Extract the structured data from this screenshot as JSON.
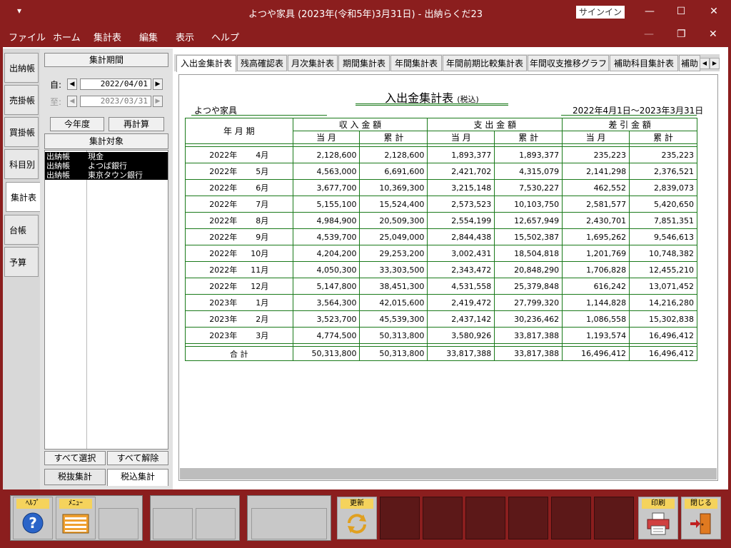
{
  "window": {
    "system_menu": "▾",
    "title": "よつや家具 (2023年(令和5年)3月31日)  -  出納らくだ23",
    "signin": "サインイン",
    "minimize": "—",
    "maximize": "☐",
    "close": "✕"
  },
  "menu": [
    "ファイル",
    "ホーム",
    "集計表",
    "編集",
    "表示",
    "ヘルプ"
  ],
  "menu_controls": {
    "minimize": "—",
    "restore": "❐",
    "close": "✕"
  },
  "left_tabs": [
    "出納帳",
    "売掛帳",
    "買掛帳",
    "科目別",
    "集計表",
    "台帳",
    "予算"
  ],
  "left_tab_active": "集計表",
  "period_panel": {
    "header": "集計期間",
    "from_label": "自:",
    "from_value": "2022/04/01",
    "to_label": "至:",
    "to_value": "2023/03/31",
    "this_year_button": "今年度",
    "recalc_button": "再計算"
  },
  "target_panel": {
    "header": "集計対象",
    "items": [
      {
        "type": "出納帳",
        "name": "現金"
      },
      {
        "type": "出納帳",
        "name": "よつば銀行"
      },
      {
        "type": "出納帳",
        "name": "東京タウン銀行"
      }
    ],
    "select_all": "すべて選択",
    "deselect_all": "すべて解除"
  },
  "tax_tabs": [
    "税抜集計",
    "税込集計"
  ],
  "tax_tab_active": "税込集計",
  "report_tabs": [
    "入出金集計表",
    "残高確認表",
    "月次集計表",
    "期間集計表",
    "年間集計表",
    "年間前期比較集計表",
    "年間収支推移グラフ",
    "補助科目集計表",
    "補助"
  ],
  "report_tab_active": "入出金集計表",
  "report": {
    "title": "入出金集計表",
    "title_suffix": "(税込)",
    "company": "よつや家具",
    "period": "2022年4月1日～2023年3月31日",
    "col_period": "年 月 期",
    "groups": [
      "収 入 金 額",
      "支 出 金 額",
      "差 引 金 額"
    ],
    "sub_current": "当 月",
    "sub_cumulative": "累 計",
    "rows": [
      {
        "year": "2022年",
        "month": "4月",
        "in_m": "2,128,600",
        "in_c": "2,128,600",
        "out_m": "1,893,377",
        "out_c": "1,893,377",
        "diff_m": "235,223",
        "diff_c": "235,223"
      },
      {
        "year": "2022年",
        "month": "5月",
        "in_m": "4,563,000",
        "in_c": "6,691,600",
        "out_m": "2,421,702",
        "out_c": "4,315,079",
        "diff_m": "2,141,298",
        "diff_c": "2,376,521"
      },
      {
        "year": "2022年",
        "month": "6月",
        "in_m": "3,677,700",
        "in_c": "10,369,300",
        "out_m": "3,215,148",
        "out_c": "7,530,227",
        "diff_m": "462,552",
        "diff_c": "2,839,073"
      },
      {
        "year": "2022年",
        "month": "7月",
        "in_m": "5,155,100",
        "in_c": "15,524,400",
        "out_m": "2,573,523",
        "out_c": "10,103,750",
        "diff_m": "2,581,577",
        "diff_c": "5,420,650"
      },
      {
        "year": "2022年",
        "month": "8月",
        "in_m": "4,984,900",
        "in_c": "20,509,300",
        "out_m": "2,554,199",
        "out_c": "12,657,949",
        "diff_m": "2,430,701",
        "diff_c": "7,851,351"
      },
      {
        "year": "2022年",
        "month": "9月",
        "in_m": "4,539,700",
        "in_c": "25,049,000",
        "out_m": "2,844,438",
        "out_c": "15,502,387",
        "diff_m": "1,695,262",
        "diff_c": "9,546,613"
      },
      {
        "year": "2022年",
        "month": "10月",
        "in_m": "4,204,200",
        "in_c": "29,253,200",
        "out_m": "3,002,431",
        "out_c": "18,504,818",
        "diff_m": "1,201,769",
        "diff_c": "10,748,382"
      },
      {
        "year": "2022年",
        "month": "11月",
        "in_m": "4,050,300",
        "in_c": "33,303,500",
        "out_m": "2,343,472",
        "out_c": "20,848,290",
        "diff_m": "1,706,828",
        "diff_c": "12,455,210"
      },
      {
        "year": "2022年",
        "month": "12月",
        "in_m": "5,147,800",
        "in_c": "38,451,300",
        "out_m": "4,531,558",
        "out_c": "25,379,848",
        "diff_m": "616,242",
        "diff_c": "13,071,452"
      },
      {
        "year": "2023年",
        "month": "1月",
        "in_m": "3,564,300",
        "in_c": "42,015,600",
        "out_m": "2,419,472",
        "out_c": "27,799,320",
        "diff_m": "1,144,828",
        "diff_c": "14,216,280"
      },
      {
        "year": "2023年",
        "month": "2月",
        "in_m": "3,523,700",
        "in_c": "45,539,300",
        "out_m": "2,437,142",
        "out_c": "30,236,462",
        "diff_m": "1,086,558",
        "diff_c": "15,302,838"
      },
      {
        "year": "2023年",
        "month": "3月",
        "in_m": "4,774,500",
        "in_c": "50,313,800",
        "out_m": "3,580,926",
        "out_c": "33,817,388",
        "diff_m": "1,193,574",
        "diff_c": "16,496,412"
      }
    ],
    "total": {
      "label": "合 計",
      "in_m": "50,313,800",
      "in_c": "50,313,800",
      "out_m": "33,817,388",
      "out_c": "33,817,388",
      "diff_m": "16,496,412",
      "diff_c": "16,496,412"
    }
  },
  "toolbar": {
    "help": "ﾍﾙﾌﾟ",
    "menu": "ﾒﾆｭｰ",
    "refresh": "更新",
    "print": "印刷",
    "close": "閉じる"
  },
  "colors": {
    "chrome": "#8b1e1e",
    "grid_line": "#1a7a1a",
    "label_bg": "#f5d35c",
    "help_blue": "#2a64c8"
  }
}
